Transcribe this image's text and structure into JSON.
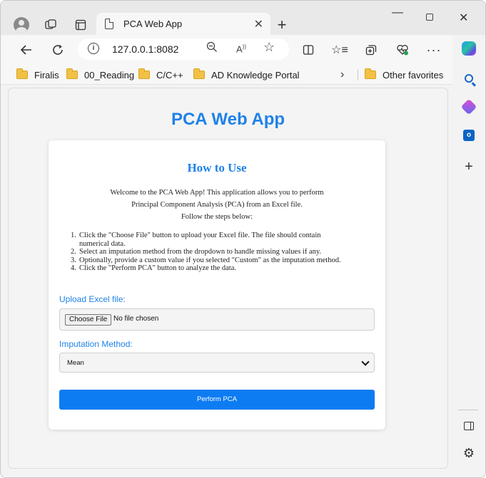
{
  "browser": {
    "tab_title": "PCA Web App",
    "url": "127.0.0.1:8082",
    "favorites": [
      "Firalis",
      "00_Reading",
      "C/C++",
      "AD Knowledge Portal"
    ],
    "other_favorites": "Other favorites"
  },
  "page": {
    "app_title": "PCA Web App",
    "how_to_title": "How to Use",
    "intro_lines": [
      "Welcome to the PCA Web App! This application allows you to perform",
      "Principal Component Analysis (PCA) from an Excel file.",
      "Follow the steps below:"
    ],
    "steps": [
      {
        "num": "1.",
        "line1": "Click the \"Choose File\" button to upload your Excel file. The file should contain",
        "line2": "numerical data."
      },
      {
        "num": "2.",
        "line1": "Select an imputation method from the dropdown to handle missing values if any.",
        "line2": ""
      },
      {
        "num": "3.",
        "line1": "Optionally, provide a custom value if you selected \"Custom\" as the imputation method.",
        "line2": ""
      },
      {
        "num": "4.",
        "line1": "Click the \"Perform PCA\" button to analyze the data.",
        "line2": ""
      }
    ],
    "upload_label": "Upload Excel file:",
    "choose_file": "Choose File",
    "no_file": "No file chosen",
    "imputation_label": "Imputation Method:",
    "imputation_value": "Mean",
    "submit_label": "Perform PCA"
  },
  "colors": {
    "accent": "#1f82e8",
    "button": "#0d7cf2"
  },
  "icons": [
    "profile-icon",
    "workspaces-icon",
    "tab-actions-icon",
    "page-icon",
    "close-icon",
    "new-tab-icon",
    "back-icon",
    "refresh-icon",
    "info-icon",
    "zoom-icon",
    "read-aloud-icon",
    "favorite-star-icon",
    "split-screen-icon",
    "favorites-icon",
    "collections-icon",
    "health-icon",
    "more-icon",
    "folder-icon",
    "chevron-right-icon",
    "copilot-icon",
    "search-icon",
    "games-icon",
    "outlook-icon",
    "add-icon",
    "sidebar-panel-icon",
    "gear-icon",
    "chevron-down-icon"
  ]
}
